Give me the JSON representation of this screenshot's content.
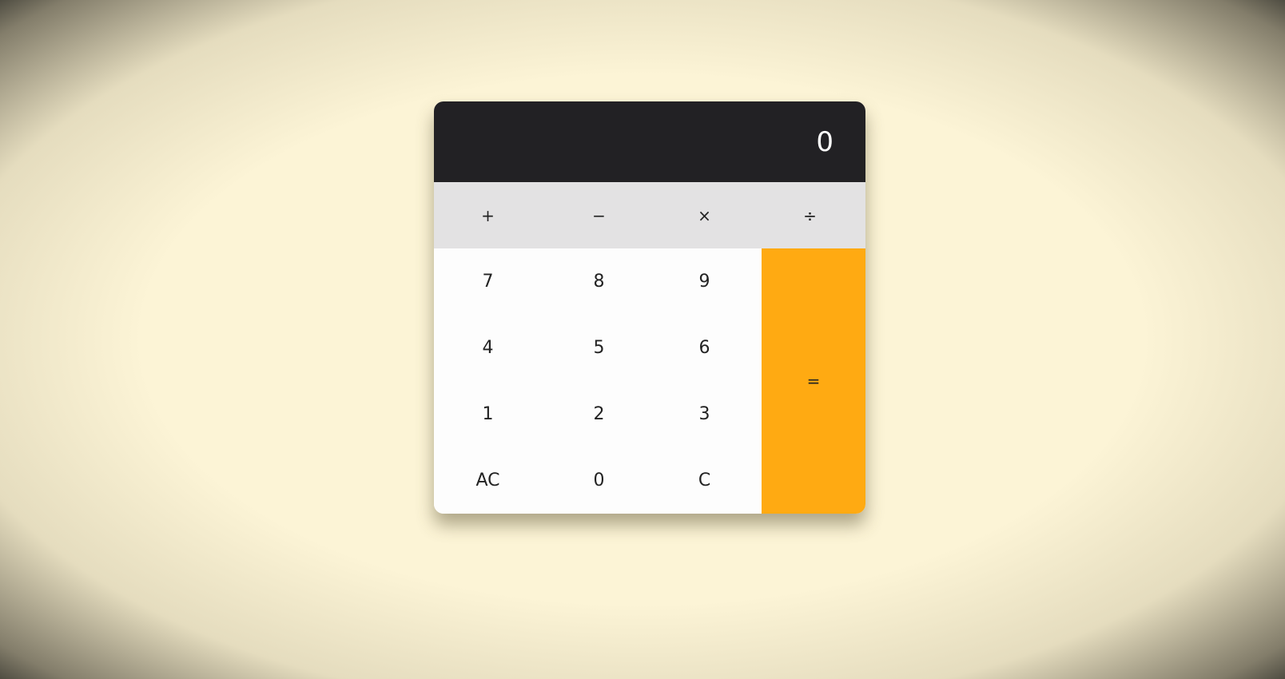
{
  "display": {
    "value": "0"
  },
  "operators": [
    "+",
    "−",
    "×",
    "÷"
  ],
  "keys": {
    "row1": [
      "7",
      "8",
      "9"
    ],
    "row2": [
      "4",
      "5",
      "6"
    ],
    "row3": [
      "1",
      "2",
      "3"
    ],
    "row4": [
      "AC",
      "0",
      "C"
    ]
  },
  "equals_label": "=",
  "colors": {
    "display_bg": "#222124",
    "operator_bg": "#e3e2e3",
    "key_bg": "#fdfdfd",
    "equals_bg": "#ffaa12",
    "page_bg": "#fcf4d6"
  }
}
